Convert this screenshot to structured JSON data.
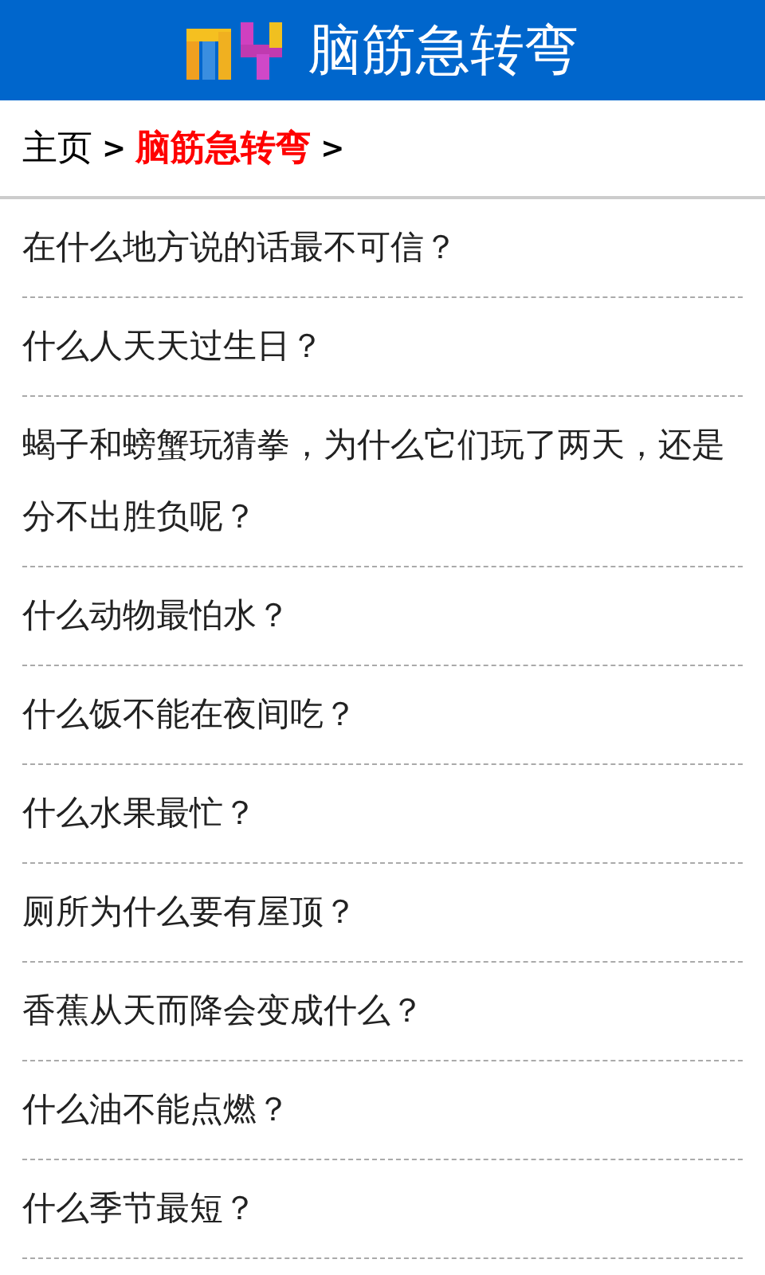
{
  "header": {
    "title": "脑筋急转弯"
  },
  "breadcrumb": [
    {
      "label": "主页",
      "current": false
    },
    {
      "label": ">",
      "kind": "separator"
    },
    {
      "label": "脑筋急转弯",
      "current": true
    },
    {
      "label": ">",
      "kind": "separator"
    }
  ],
  "questions": [
    "在什么地方说的话最不可信？",
    "什么人天天过生日？",
    "蝎子和螃蟹玩猜拳，为什么它们玩了两天，还是分不出胜负呢？",
    "什么动物最怕水？",
    "什么饭不能在夜间吃？",
    "什么水果最忙？",
    "厕所为什么要有屋顶？",
    "香蕉从天而降会变成什么？",
    "什么油不能点燃？",
    "什么季节最短？"
  ]
}
